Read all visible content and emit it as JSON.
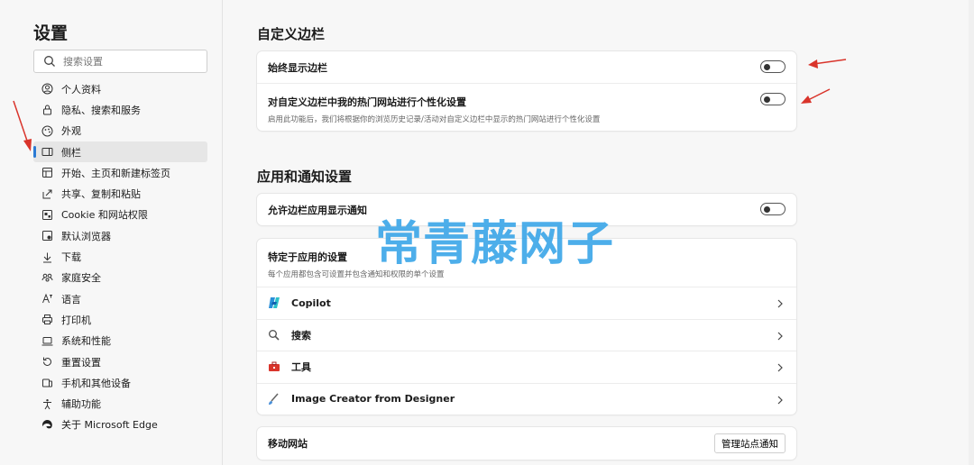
{
  "sidebar": {
    "title": "设置",
    "search_placeholder": "搜索设置",
    "items": [
      {
        "label": "个人资料",
        "icon": "profile-icon"
      },
      {
        "label": "隐私、搜索和服务",
        "icon": "lock-icon"
      },
      {
        "label": "外观",
        "icon": "appearance-icon"
      },
      {
        "label": "侧栏",
        "icon": "sidebar-icon",
        "active": true
      },
      {
        "label": "开始、主页和新建标签页",
        "icon": "home-icon"
      },
      {
        "label": "共享、复制和粘贴",
        "icon": "share-icon"
      },
      {
        "label": "Cookie 和网站权限",
        "icon": "cookie-icon"
      },
      {
        "label": "默认浏览器",
        "icon": "browser-icon"
      },
      {
        "label": "下载",
        "icon": "download-icon"
      },
      {
        "label": "家庭安全",
        "icon": "family-icon"
      },
      {
        "label": "语言",
        "icon": "language-icon"
      },
      {
        "label": "打印机",
        "icon": "printer-icon"
      },
      {
        "label": "系统和性能",
        "icon": "laptop-icon"
      },
      {
        "label": "重置设置",
        "icon": "reset-icon"
      },
      {
        "label": "手机和其他设备",
        "icon": "phone-icon"
      },
      {
        "label": "辅助功能",
        "icon": "accessibility-icon"
      },
      {
        "label": "关于 Microsoft Edge",
        "icon": "edge-icon"
      }
    ]
  },
  "main": {
    "section1": {
      "title": "自定义边栏",
      "always_show": {
        "label": "始终显示边栏",
        "enabled": false
      },
      "personalize": {
        "label": "对自定义边栏中我的热门网站进行个性化设置",
        "desc": "启用此功能后，我们将根据你的浏览历史记录/活动对自定义边栏中显示的热门网站进行个性化设置",
        "enabled": false
      }
    },
    "section2": {
      "title": "应用和通知设置",
      "allow_notify": {
        "label": "允许边栏应用显示通知",
        "enabled": false
      },
      "app_specific": {
        "title": "特定于应用的设置",
        "desc": "每个应用都包含可设置并包含通知和权限的单个设置",
        "apps": [
          {
            "label": "Copilot",
            "icon": "copilot-icon"
          },
          {
            "label": "搜索",
            "icon": "search-icon"
          },
          {
            "label": "工具",
            "icon": "toolbox-icon"
          },
          {
            "label": "Image Creator from Designer",
            "icon": "image-creator-icon"
          }
        ]
      },
      "mobile": {
        "label": "移动网站",
        "button": "管理站点通知"
      }
    }
  },
  "watermark": "常青藤网子",
  "colors": {
    "accent": "#2b7bd4",
    "annotation_arrow": "#d9342b",
    "watermark": "#3aa6e8"
  }
}
